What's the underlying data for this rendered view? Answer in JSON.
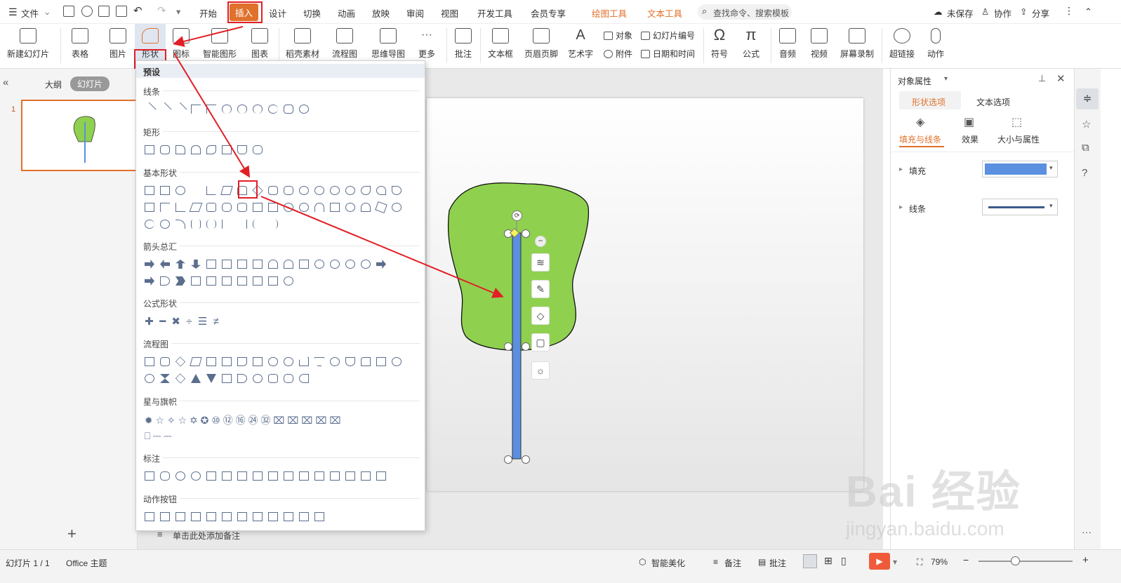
{
  "menubar": {
    "file_label": "文件",
    "tabs": [
      "开始",
      "插入",
      "设计",
      "切换",
      "动画",
      "放映",
      "审阅",
      "视图",
      "开发工具",
      "会员专享"
    ],
    "context_tabs": [
      "绘图工具",
      "文本工具"
    ],
    "search_placeholder": "查找命令、搜索模板",
    "unsaved_label": "未保存",
    "collab_label": "协作",
    "share_label": "分享"
  },
  "ribbon": {
    "buttons": [
      {
        "label": "新建幻灯片",
        "icon": "new-slide-icon"
      },
      {
        "label": "表格",
        "icon": "table-icon"
      },
      {
        "label": "图片",
        "icon": "picture-icon"
      },
      {
        "label": "形状",
        "icon": "shape-icon"
      },
      {
        "label": "图标",
        "icon": "icons-icon"
      },
      {
        "label": "智能图形",
        "icon": "smartart-icon"
      },
      {
        "label": "图表",
        "icon": "chart-icon"
      },
      {
        "label": "稻壳素材",
        "icon": "docer-icon"
      },
      {
        "label": "流程图",
        "icon": "flowchart-icon"
      },
      {
        "label": "思维导图",
        "icon": "mindmap-icon"
      },
      {
        "label": "更多",
        "icon": "more-icon"
      },
      {
        "label": "批注",
        "icon": "comment-icon"
      },
      {
        "label": "文本框",
        "icon": "textbox-icon"
      },
      {
        "label": "页眉页脚",
        "icon": "header-footer-icon"
      },
      {
        "label": "艺术字",
        "icon": "wordart-icon"
      },
      {
        "label": "符号",
        "icon": "omega-icon"
      },
      {
        "label": "公式",
        "icon": "pi-icon"
      },
      {
        "label": "音频",
        "icon": "audio-icon"
      },
      {
        "label": "视频",
        "icon": "video-icon"
      },
      {
        "label": "屏幕录制",
        "icon": "screen-record-icon"
      },
      {
        "label": "超链接",
        "icon": "link-icon"
      },
      {
        "label": "动作",
        "icon": "mouse-icon"
      }
    ],
    "small": {
      "object": "对象",
      "slide_number": "幻灯片编号",
      "attachment": "附件",
      "datetime": "日期和时间"
    }
  },
  "left_panel": {
    "outline_tab": "大纲",
    "slides_tab": "幻灯片",
    "slide_number": "1"
  },
  "notes_placeholder": "单击此处添加备注",
  "shapes_menu": {
    "preset": "预设",
    "categories": [
      "线条",
      "矩形",
      "基本形状",
      "箭头总汇",
      "公式形状",
      "流程图",
      "星与旗帜",
      "标注",
      "动作按钮"
    ]
  },
  "right_panel": {
    "title": "对象属性",
    "tabs": [
      "形状选项",
      "文本选项"
    ],
    "subtabs": [
      "填充与线条",
      "效果",
      "大小与属性"
    ],
    "fill_label": "填充",
    "line_label": "线条",
    "fill_color": "#5b8fe0",
    "line_color": "#3d5a8c"
  },
  "statusbar": {
    "slide_info": "幻灯片 1 / 1",
    "theme": "Office 主题",
    "beautify": "智能美化",
    "notes": "备注",
    "comments": "批注",
    "zoom": "79%"
  },
  "watermark": {
    "brand": "Bai 经验",
    "url": "jingyan.baidu.com"
  },
  "colors": {
    "accent_red": "#e21f26",
    "tree_green": "#8fd14f",
    "trunk_blue": "#5b8fe0",
    "context_tab": "#e0712c"
  }
}
